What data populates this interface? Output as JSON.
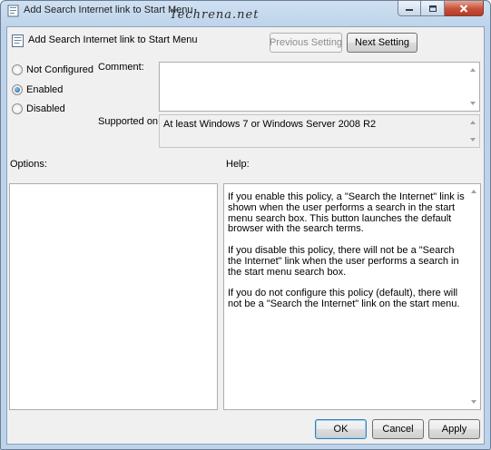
{
  "window": {
    "title": "Add Search Internet link to Start Menu",
    "watermark": "Techrena.net"
  },
  "policy": {
    "title": "Add Search Internet link to Start Menu"
  },
  "nav": {
    "previous_label": "Previous Setting",
    "next_label": "Next Setting"
  },
  "state": {
    "options": [
      {
        "label": "Not Configured",
        "checked": false
      },
      {
        "label": "Enabled",
        "checked": true
      },
      {
        "label": "Disabled",
        "checked": false
      }
    ]
  },
  "comment": {
    "label": "Comment:",
    "value": ""
  },
  "supported": {
    "label": "Supported on:",
    "value": "At least Windows 7 or Windows Server 2008 R2"
  },
  "options_label": "Options:",
  "help": {
    "label": "Help:",
    "paragraphs": [
      "If you enable this policy, a \"Search the Internet\" link is shown when the user performs a search in the start menu search box. This button launches the default browser with the search terms.",
      "If you disable this policy, there will not be a \"Search the Internet\" link when the user performs a search in the start menu search box.",
      "If you do not configure this policy (default), there will not be a \"Search the Internet\" link on the start menu."
    ]
  },
  "footer": {
    "ok_label": "OK",
    "cancel_label": "Cancel",
    "apply_label": "Apply"
  },
  "icons": {
    "title_icon": "policy-settings-icon",
    "minimize": "minimize-icon",
    "maximize": "maximize-icon",
    "close": "close-icon",
    "radio_selected_color": "#1b5a8f"
  }
}
